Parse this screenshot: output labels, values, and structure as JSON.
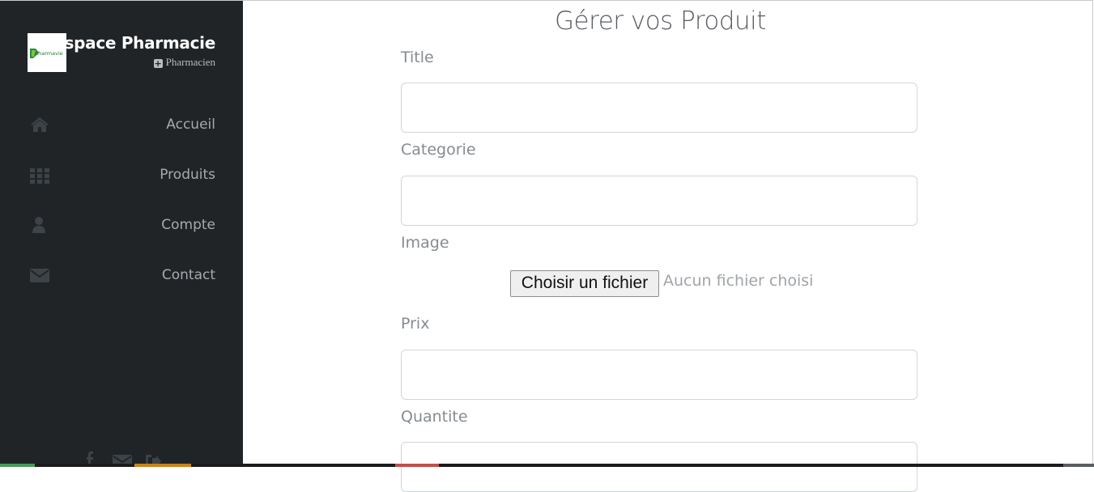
{
  "sidebar": {
    "brand": {
      "logo_text": "pharmavie",
      "title": "Espace Pharmacie",
      "subtitle": "Pharmacien"
    },
    "items": [
      {
        "label": "Accueil",
        "icon": "home-icon"
      },
      {
        "label": "Produits",
        "icon": "grid-icon"
      },
      {
        "label": "Compte",
        "icon": "user-icon"
      },
      {
        "label": "Contact",
        "icon": "envelope-icon"
      }
    ],
    "social": [
      "facebook-icon",
      "envelope-icon",
      "sign-out-icon"
    ]
  },
  "main": {
    "title": "Gérer vos Produit",
    "fields": {
      "title_label": "Title",
      "categorie_label": "Categorie",
      "image_label": "Image",
      "prix_label": "Prix",
      "quantite_label": "Quantite"
    },
    "file_input": {
      "button_label": "Choisir un fichier",
      "status": "Aucun fichier choisi"
    }
  },
  "colors": {
    "sidebar_bg": "#212427",
    "accent_green": "#4a9a4a",
    "accent_orange": "#c8841f",
    "accent_red": "#c0504d"
  }
}
